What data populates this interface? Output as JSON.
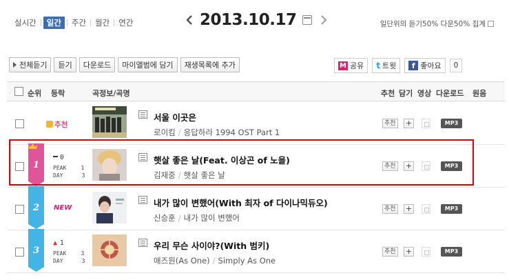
{
  "period_tabs": [
    {
      "label": "실시간",
      "active": false
    },
    {
      "label": "일간",
      "active": true
    },
    {
      "label": "주간",
      "active": false
    },
    {
      "label": "월간",
      "active": false
    },
    {
      "label": "연간",
      "active": false
    }
  ],
  "date_nav": {
    "date": "2013.10.17",
    "prev_icon": "chevron-left-icon",
    "next_icon": "chevron-right-icon",
    "calendar_icon": "calendar-icon"
  },
  "notice": "일단위의 듣기50% 다운50% 집계",
  "actions": [
    {
      "label": "전체듣기"
    },
    {
      "label": "듣기"
    },
    {
      "label": "다운로드"
    },
    {
      "label": "마이앨범에 담기"
    },
    {
      "label": "재생목록에 추가"
    }
  ],
  "social": {
    "share_label": "공유",
    "tweet_label": "트윗",
    "like_label": "좋아요",
    "like_count": "0"
  },
  "table_header": {
    "rank": "순위",
    "change": "등락",
    "song_info": "곡정보/곡명",
    "recommend": "추천",
    "add": "담기",
    "video": "영상",
    "download": "다운로드",
    "original": "원음"
  },
  "rows": [
    {
      "rank": "",
      "badge": "추천",
      "title": "서울 이곳은",
      "artist": "로이킴",
      "album": "응답하라 1994 OST Part 1",
      "highlighted": false
    },
    {
      "rank": "1",
      "change": "0",
      "change_dir": "same",
      "peak": "1",
      "day": "3",
      "title": "햇살 좋은 날(Feat. 이상곤 of 노을)",
      "artist": "김재중",
      "album": "햇살 좋은 날",
      "highlighted": true
    },
    {
      "rank": "2",
      "badge": "NEW",
      "title": "내가 많이 변했어(With 최자 of 다이나믹듀오)",
      "artist": "신승훈",
      "album": "내가 많이 변했어",
      "highlighted": false
    },
    {
      "rank": "3",
      "change": "1",
      "change_dir": "up",
      "peak": "3",
      "day": "3",
      "title": "우리 무슨 사이야?(With 범키)",
      "artist": "애즈원(As One)",
      "album": "Simply As One",
      "highlighted": false
    }
  ],
  "row_buttons": {
    "recommend": "추천",
    "add": "+",
    "mp3": "MP3"
  },
  "labels": {
    "peak": "PEAK",
    "day": "DAY"
  },
  "colors": {
    "accent": "#3c6cb4",
    "rank1": "#e0559a",
    "rank_other": "#43b4e6",
    "highlight_border": "#e00000"
  }
}
